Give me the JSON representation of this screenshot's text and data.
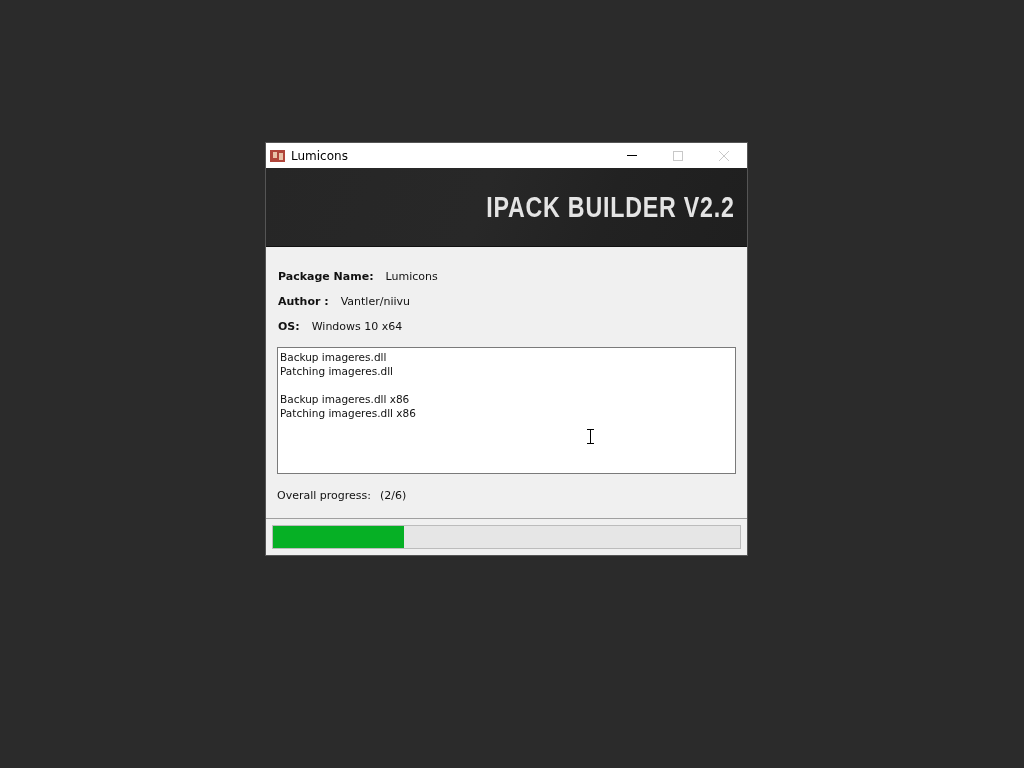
{
  "window": {
    "title": "Lumicons"
  },
  "banner": {
    "title": "IPACK BUILDER V2.2"
  },
  "info": [
    {
      "label": "Package Name:",
      "value": "Lumicons"
    },
    {
      "label": "Author :",
      "value": "Vantler/niivu"
    },
    {
      "label": "OS:",
      "value": "Windows 10 x64"
    }
  ],
  "log": [
    [
      "Backup imageres.dll",
      "Patching imageres.dll"
    ],
    [
      "Backup imageres.dll x86",
      "Patching imageres.dll x86"
    ]
  ],
  "progress": {
    "label": "Overall progress:",
    "count": "(2/6)",
    "level": 0.28
  }
}
